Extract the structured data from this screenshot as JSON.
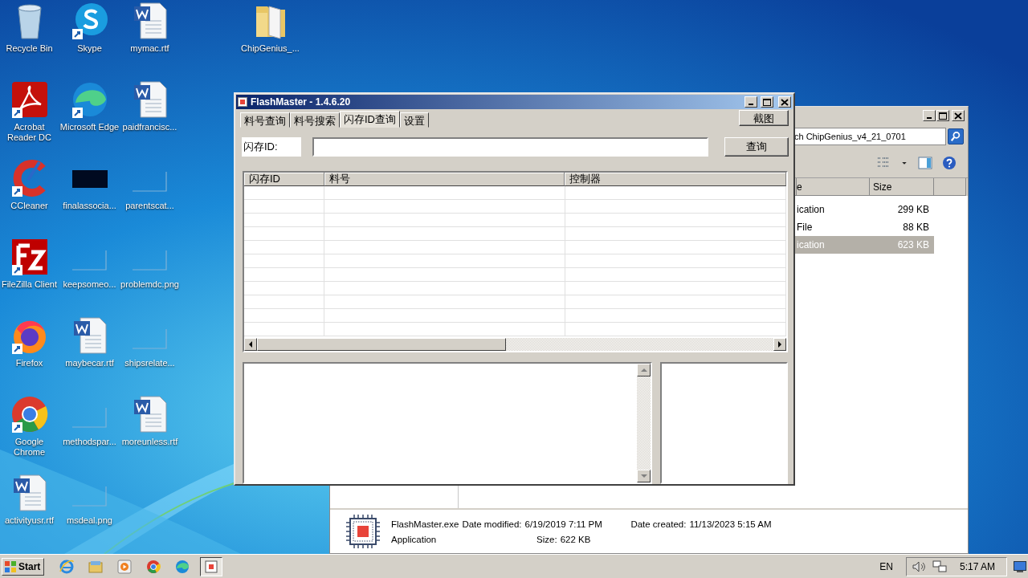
{
  "desktop": {
    "icons": [
      {
        "label": "Recycle Bin",
        "kind": "recycle"
      },
      {
        "label": "Skype",
        "kind": "skype"
      },
      {
        "label": "mymac.rtf",
        "kind": "word"
      },
      {
        "label": "ChipGenius_...",
        "kind": "folder"
      },
      {
        "label": "Acrobat Reader DC",
        "kind": "acrobat"
      },
      {
        "label": "Microsoft Edge",
        "kind": "edge"
      },
      {
        "label": "paidfrancisc...",
        "kind": "word"
      },
      {
        "label": "CCleaner",
        "kind": "ccleaner"
      },
      {
        "label": "finalassocia...",
        "kind": "dark"
      },
      {
        "label": "parentscat...",
        "kind": "blank"
      },
      {
        "label": "FileZilla Client",
        "kind": "filezilla"
      },
      {
        "label": "keepsomeo...",
        "kind": "blank"
      },
      {
        "label": "problemdc.png",
        "kind": "blank"
      },
      {
        "label": "Firefox",
        "kind": "firefox"
      },
      {
        "label": "maybecar.rtf",
        "kind": "word"
      },
      {
        "label": "shipsrelate...",
        "kind": "blank"
      },
      {
        "label": "Google Chrome",
        "kind": "chrome"
      },
      {
        "label": "methodspar...",
        "kind": "blank"
      },
      {
        "label": "moreunless.rtf",
        "kind": "word"
      },
      {
        "label": "activityusr.rtf",
        "kind": "word"
      },
      {
        "label": "msdeal.png",
        "kind": "blank"
      }
    ]
  },
  "explorer": {
    "search_value": "ch ChipGenius_v4_21_0701",
    "columns": [
      "e",
      "Size"
    ],
    "rows": [
      {
        "column_1": "ication",
        "size": "299 KB",
        "selected": false
      },
      {
        "column_1": "File",
        "size": "88 KB",
        "selected": false
      },
      {
        "column_1": "ication",
        "size": "623 KB",
        "selected": true
      }
    ],
    "details": {
      "name": "FlashMaster.exe",
      "type": "Application",
      "modified_label": "Date modified:",
      "modified": "6/19/2019 7:11 PM",
      "size_label": "Size:",
      "size": "622 KB",
      "created_label": "Date created:",
      "created": "11/13/2023 5:15 AM"
    }
  },
  "flashmaster": {
    "title": "FlashMaster - 1.4.6.20",
    "tabs": [
      {
        "label": "料号查询",
        "selected": false
      },
      {
        "label": "料号搜索",
        "selected": false
      },
      {
        "label": "闪存ID查询",
        "selected": true
      },
      {
        "label": "设置",
        "selected": false
      }
    ],
    "screenshot_button": "截图",
    "id_label": "闪存ID:",
    "query_button": "查询",
    "table": {
      "columns": [
        "闪存ID",
        "料号",
        "控制器"
      ]
    }
  },
  "taskbar": {
    "start": "Start",
    "apps": [
      {
        "kind": "ie",
        "selected": false
      },
      {
        "kind": "explorer",
        "selected": false
      },
      {
        "kind": "media",
        "selected": false
      },
      {
        "kind": "chrome",
        "selected": false
      },
      {
        "kind": "edge",
        "selected": false
      },
      {
        "kind": "chip",
        "selected": true
      }
    ],
    "language": "EN",
    "clock": "5:17 AM"
  }
}
